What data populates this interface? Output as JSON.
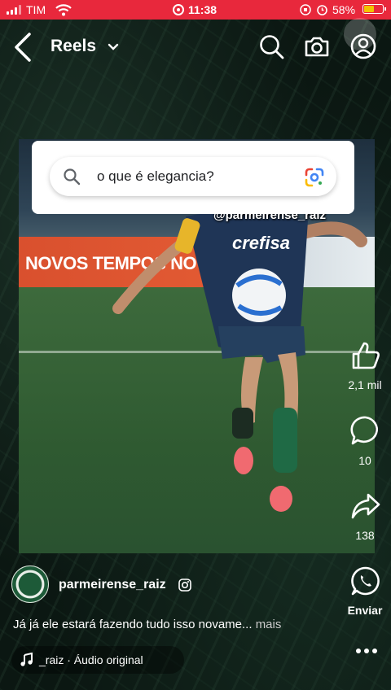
{
  "status_bar": {
    "carrier": "TIM",
    "time": "11:38",
    "battery": "58%"
  },
  "header": {
    "title": "Reels"
  },
  "search": {
    "query": "o que é elegancia?"
  },
  "video": {
    "banner_text": "NOVOS TEMPOS NO",
    "overlay_handle": "@parmeirense_raiz",
    "jersey_text": "crefisa"
  },
  "actions": {
    "likes": "2,1 mil",
    "comments": "10",
    "shares": "138",
    "whatsapp_label": "Enviar"
  },
  "post": {
    "username": "parmeirense_raiz",
    "caption": "Já já ele estará fazendo tudo isso novame...",
    "more_label": "mais",
    "audio": "_raiz · Áudio original"
  },
  "icons": [
    "back-arrow-icon",
    "chevron-down-icon",
    "search-icon",
    "camera-icon",
    "profile-icon",
    "like-icon",
    "comment-icon",
    "share-icon",
    "whatsapp-icon",
    "more-icon",
    "music-note-icon",
    "instagram-icon",
    "google-lens-icon"
  ],
  "colors": {
    "status_bar": "#e8283c",
    "battery_fill": "#f2c400"
  }
}
